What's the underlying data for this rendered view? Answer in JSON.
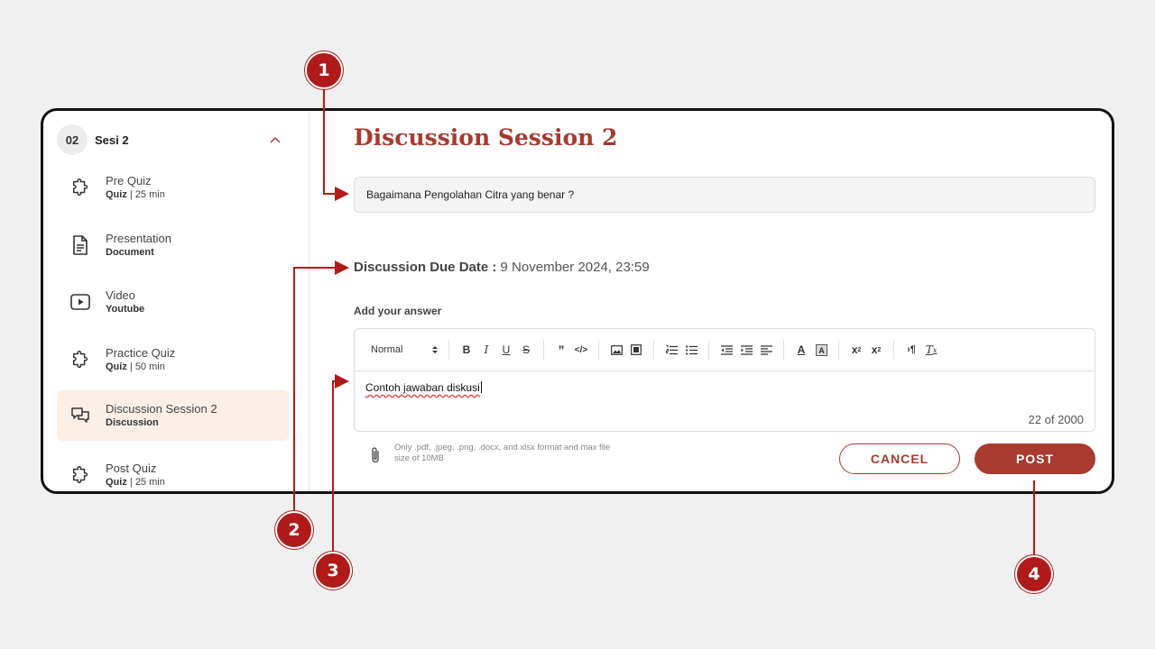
{
  "sidebar": {
    "session": {
      "number": "02",
      "name": "Sesi 2",
      "toggle_icon": "chevron-up-icon"
    },
    "items": [
      {
        "title": "Pre Quiz",
        "type": "Quiz",
        "meta": " | 25 min",
        "icon": "puzzle-icon",
        "active": false
      },
      {
        "title": "Presentation",
        "type": "Document",
        "meta": "",
        "icon": "document-icon",
        "active": false
      },
      {
        "title": "Video",
        "type": "Youtube",
        "meta": "",
        "icon": "play-icon",
        "active": false
      },
      {
        "title": "Practice Quiz",
        "type": "Quiz",
        "meta": " | 50 min",
        "icon": "puzzle-icon",
        "active": false
      },
      {
        "title": "Discussion Session 2",
        "type": "Discussion",
        "meta": "",
        "icon": "chat-icon",
        "active": true
      },
      {
        "title": "Post Quiz",
        "type": "Quiz",
        "meta": " | 25 min",
        "icon": "puzzle-icon",
        "active": false
      }
    ]
  },
  "main": {
    "title": "Discussion Session 2",
    "question": "Bagaimana Pengolahan Citra yang benar ?",
    "due_label": "Discussion Due Date :",
    "due_value": "9 November 2024, 23:59",
    "answer_label": "Add your answer",
    "editor": {
      "format_select": "Normal",
      "content": "Contoh jawaban diskusi",
      "char_count": "22",
      "char_of": "of",
      "char_max": "2000"
    },
    "attachment_note": "Only .pdf, .jpeg, .png, .docx, and xlsx format and max file size of 10MB",
    "cancel_label": "CANCEL",
    "post_label": "POST"
  },
  "annotations": [
    "1",
    "2",
    "3",
    "4"
  ],
  "colors": {
    "accent": "#a83a30",
    "annotation": "#b11a1a",
    "active_bg": "#fbefe6"
  }
}
